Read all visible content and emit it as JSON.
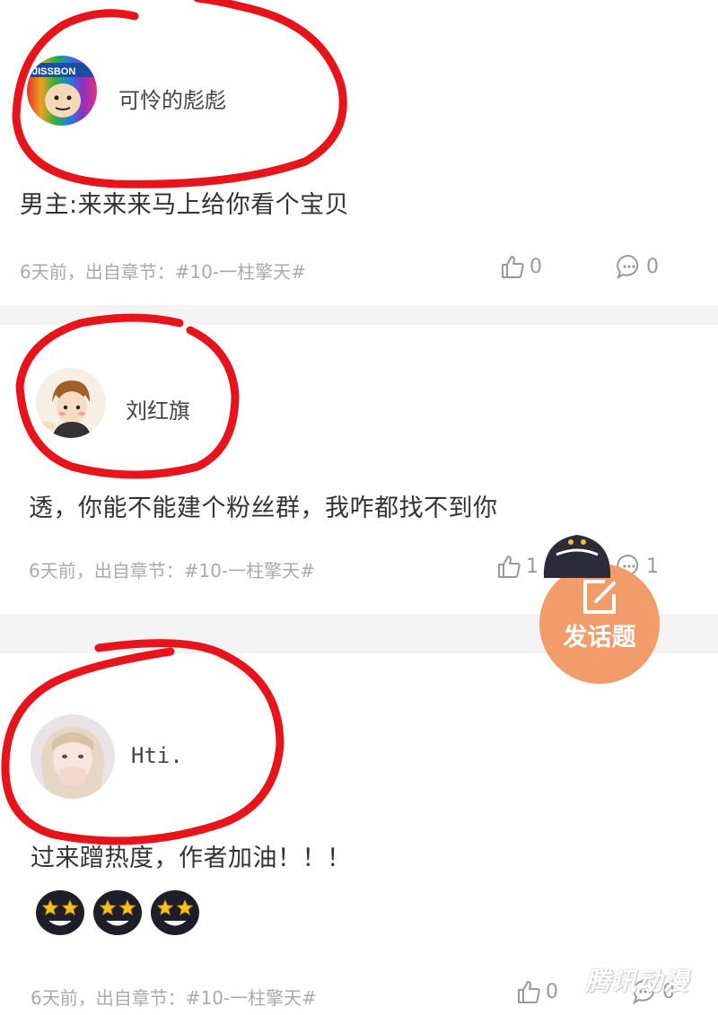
{
  "comments": [
    {
      "username": "可怜的彪彪",
      "avatar_badge": "JISSBON",
      "text": "男主:来来来马上给你看个宝贝",
      "meta": "6天前，出自章节：#10-一柱擎天#",
      "likes": "0",
      "replies": "0"
    },
    {
      "username": "刘红旗",
      "text": "透，你能不能建个粉丝群，我咋都找不到你",
      "meta": "6天前，出自章节：#10-一柱擎天#",
      "likes": "1",
      "replies": "1"
    },
    {
      "username": "Hti.",
      "text": "过来蹭热度，作者加油！！！",
      "emoji_count": 3,
      "meta": "6天前，出自章节：#10-一柱擎天#",
      "likes": "0",
      "replies": "0"
    }
  ],
  "fab": {
    "label": "发话题"
  },
  "watermark": "腾讯动漫",
  "colors": {
    "annotation_red": "#e8141c",
    "fab_orange": "#f39c6b",
    "meta_gray": "#aaaaaa"
  },
  "icons": [
    "thumbs-up-icon",
    "comment-bubble-icon",
    "edit-icon",
    "star-eyes-emoji"
  ]
}
